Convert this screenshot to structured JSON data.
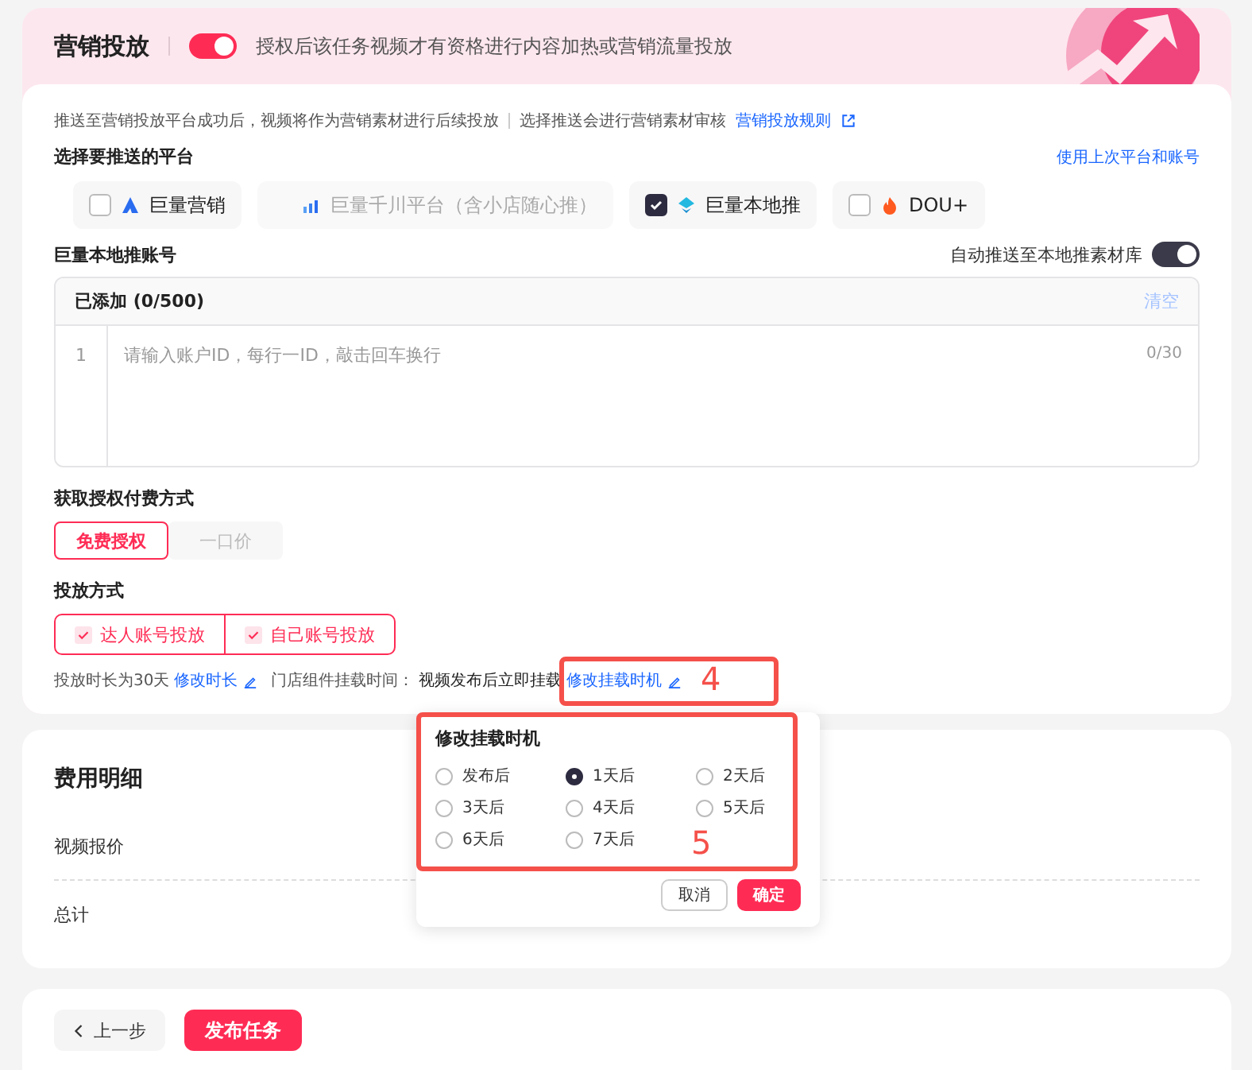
{
  "header": {
    "title": "营销投放",
    "toggle_on": true,
    "description": "授权后该任务视频才有资格进行内容加热或营销流量投放"
  },
  "notice": {
    "text": "推送至营销投放平台成功后，视频将作为营销素材进行后续投放",
    "text2": "选择推送会进行营销素材审核",
    "link": "营销投放规则"
  },
  "platforms": {
    "title": "选择要推送的平台",
    "link": "使用上次平台和账号",
    "items": [
      {
        "name": "巨量营销",
        "checked": false,
        "disabled": false,
        "kind": "triangle"
      },
      {
        "name": "巨量千川平台（含小店随心推）",
        "checked": false,
        "disabled": true,
        "kind": "bars"
      },
      {
        "name": "巨量本地推",
        "checked": true,
        "disabled": false,
        "kind": "diamond"
      },
      {
        "name": "DOU+",
        "checked": false,
        "disabled": false,
        "kind": "flame"
      }
    ]
  },
  "account": {
    "title": "巨量本地推账号",
    "auto_push_label": "自动推送至本地推素材库",
    "auto_push_on": true,
    "list_title": "已添加 (0/500)",
    "clear": "清空",
    "line_number": "1",
    "placeholder": "请输入账户ID，每行一ID，敲击回车换行",
    "counter": "0/30"
  },
  "payment": {
    "title": "获取授权付费方式",
    "options": [
      {
        "label": "免费授权",
        "selected": true,
        "disabled": false
      },
      {
        "label": "一口价",
        "selected": false,
        "disabled": true
      }
    ]
  },
  "delivery": {
    "title": "投放方式",
    "options": [
      {
        "label": "达人账号投放",
        "checked": true
      },
      {
        "label": "自己账号投放",
        "checked": true
      }
    ]
  },
  "schedule": {
    "duration": "投放时长为30天",
    "duration_link": "修改时长",
    "mount_label": "门店组件挂载时间：",
    "mount_value": "视频发布后立即挂载",
    "mount_link": "修改挂载时机"
  },
  "popup": {
    "title": "修改挂载时机",
    "options": [
      {
        "label": "发布后",
        "selected": false
      },
      {
        "label": "1天后",
        "selected": true
      },
      {
        "label": "2天后",
        "selected": false
      },
      {
        "label": "3天后",
        "selected": false
      },
      {
        "label": "4天后",
        "selected": false
      },
      {
        "label": "5天后",
        "selected": false
      },
      {
        "label": "6天后",
        "selected": false
      },
      {
        "label": "7天后",
        "selected": false
      }
    ],
    "cancel": "取消",
    "confirm": "确定"
  },
  "fees": {
    "title": "费用明细",
    "rows": [
      {
        "label": "视频报价"
      },
      {
        "label": "总计"
      }
    ]
  },
  "footer": {
    "back": "上一步",
    "publish": "发布任务"
  },
  "annotations": [
    {
      "label": "4"
    },
    {
      "label": "5"
    }
  ]
}
